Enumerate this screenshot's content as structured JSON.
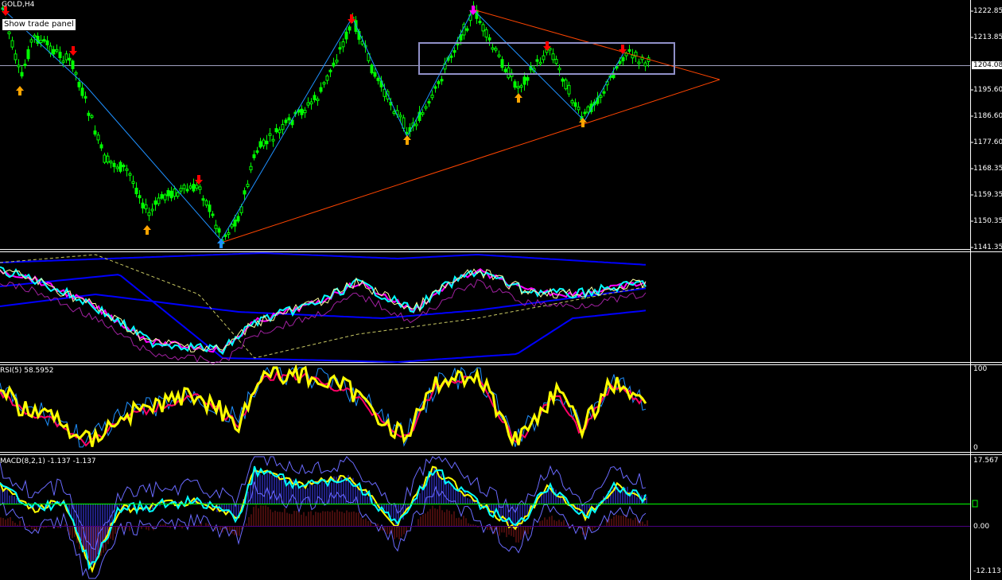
{
  "symbol_label": "GOLD,H4",
  "trade_panel_button": "Show trade panel",
  "price_axis": {
    "ticks": [
      "1222.85",
      "1213.85",
      "1204.08",
      "1195.60",
      "1186.60",
      "1177.60",
      "1168.35",
      "1159.35",
      "1150.35",
      "1141.35"
    ],
    "current_price": "1204.08"
  },
  "rsi": {
    "label": "RSI(5) 58.5952",
    "scale_top": "100",
    "scale_bottom": "0"
  },
  "macd": {
    "label": "MACD(8,2,1) -1.137 -1.137",
    "scale_top": "17.567",
    "scale_mid": "0.00",
    "scale_bottom": "-12.113"
  },
  "colors": {
    "candle": "#00ff00",
    "zigzag": "#1e90ff",
    "trendline": "#ff4500",
    "box": "#9090c8",
    "up_arrow": "#ffa500",
    "down_arrow": "#ff0000",
    "peak_arrow": "#ff00ff",
    "trough_arrow": "#1e90ff",
    "rsi_main": "#ffff00",
    "rsi_signal": "#ff0066",
    "macd_hist": "#4040ff",
    "macd_line": "#00ffff",
    "signal_line": "#ffff00",
    "zero_line": "#00ff00"
  }
}
